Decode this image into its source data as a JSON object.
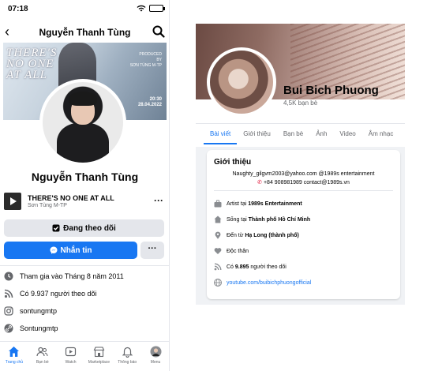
{
  "left": {
    "status": {
      "time": "07:18"
    },
    "nav": {
      "title": "Nguyễn Thanh Tùng"
    },
    "cover": {
      "poster_line1": "THERE'S",
      "poster_line2": "NO ONE",
      "poster_line3": "AT ALL",
      "poster_info1": "PRODUCED",
      "poster_info2": "BY",
      "poster_info3": "SƠN TÙNG M-TP",
      "poster_time": "20:30",
      "poster_date": "28.04.2022"
    },
    "name": "Nguyễn Thanh Tùng",
    "music": {
      "title": "THERE'S NO ONE AT ALL",
      "artist": "Sơn Tùng M-TP"
    },
    "buttons": {
      "follow": "Đang theo dõi",
      "message": "Nhắn tin",
      "more": "···"
    },
    "info": [
      {
        "icon": "clock-icon",
        "text": "Tham gia vào Tháng 8 năm 2011"
      },
      {
        "icon": "rss-icon",
        "text": "Có 9.937 người theo dõi"
      },
      {
        "icon": "instagram-icon",
        "text": "sontungmtp"
      },
      {
        "icon": "link-icon",
        "text": "Sontungmtp"
      }
    ],
    "tabbar": [
      {
        "label": "Trang chủ",
        "icon": "home-icon"
      },
      {
        "label": "Bạn bè",
        "icon": "friends-icon"
      },
      {
        "label": "Watch",
        "icon": "watch-icon"
      },
      {
        "label": "Marketplace",
        "icon": "marketplace-icon"
      },
      {
        "label": "Thông báo",
        "icon": "bell-icon"
      },
      {
        "label": "Menu",
        "icon": "menu-avatar-icon"
      }
    ]
  },
  "right": {
    "name": "Bui Bich Phuong",
    "friends": "4,5K bạn bè",
    "tabs": [
      "Bài viết",
      "Giới thiệu",
      "Bạn bè",
      "Ảnh",
      "Video",
      "Âm nhạc"
    ],
    "intro": {
      "title": "Giới thiệu",
      "bio1": "Naughty_gilgvm2003@yahoo.com @1989s entertainment",
      "bio2": "+84 908981989 contact@1989s.vn",
      "rows": [
        {
          "icon": "briefcase-icon",
          "prefix": "Artist tại ",
          "bold": "1989s Entertainment"
        },
        {
          "icon": "house-icon",
          "prefix": "Sống tại ",
          "bold": "Thành phố Hồ Chí Minh"
        },
        {
          "icon": "location-pin-icon",
          "prefix": "Đến từ ",
          "bold": "Hạ Long (thành phố)"
        },
        {
          "icon": "heart-icon",
          "prefix": "Độc thân",
          "bold": ""
        },
        {
          "icon": "rss-icon",
          "prefix": "Có ",
          "bold": "9.895",
          "suffix": " người theo dõi"
        },
        {
          "icon": "globe-icon",
          "link": "youtube.com/buibichphuongofficial"
        }
      ]
    }
  },
  "colors": {
    "accent": "#1877f2",
    "muted": "#65676b",
    "button_gray": "#e4e6eb"
  }
}
